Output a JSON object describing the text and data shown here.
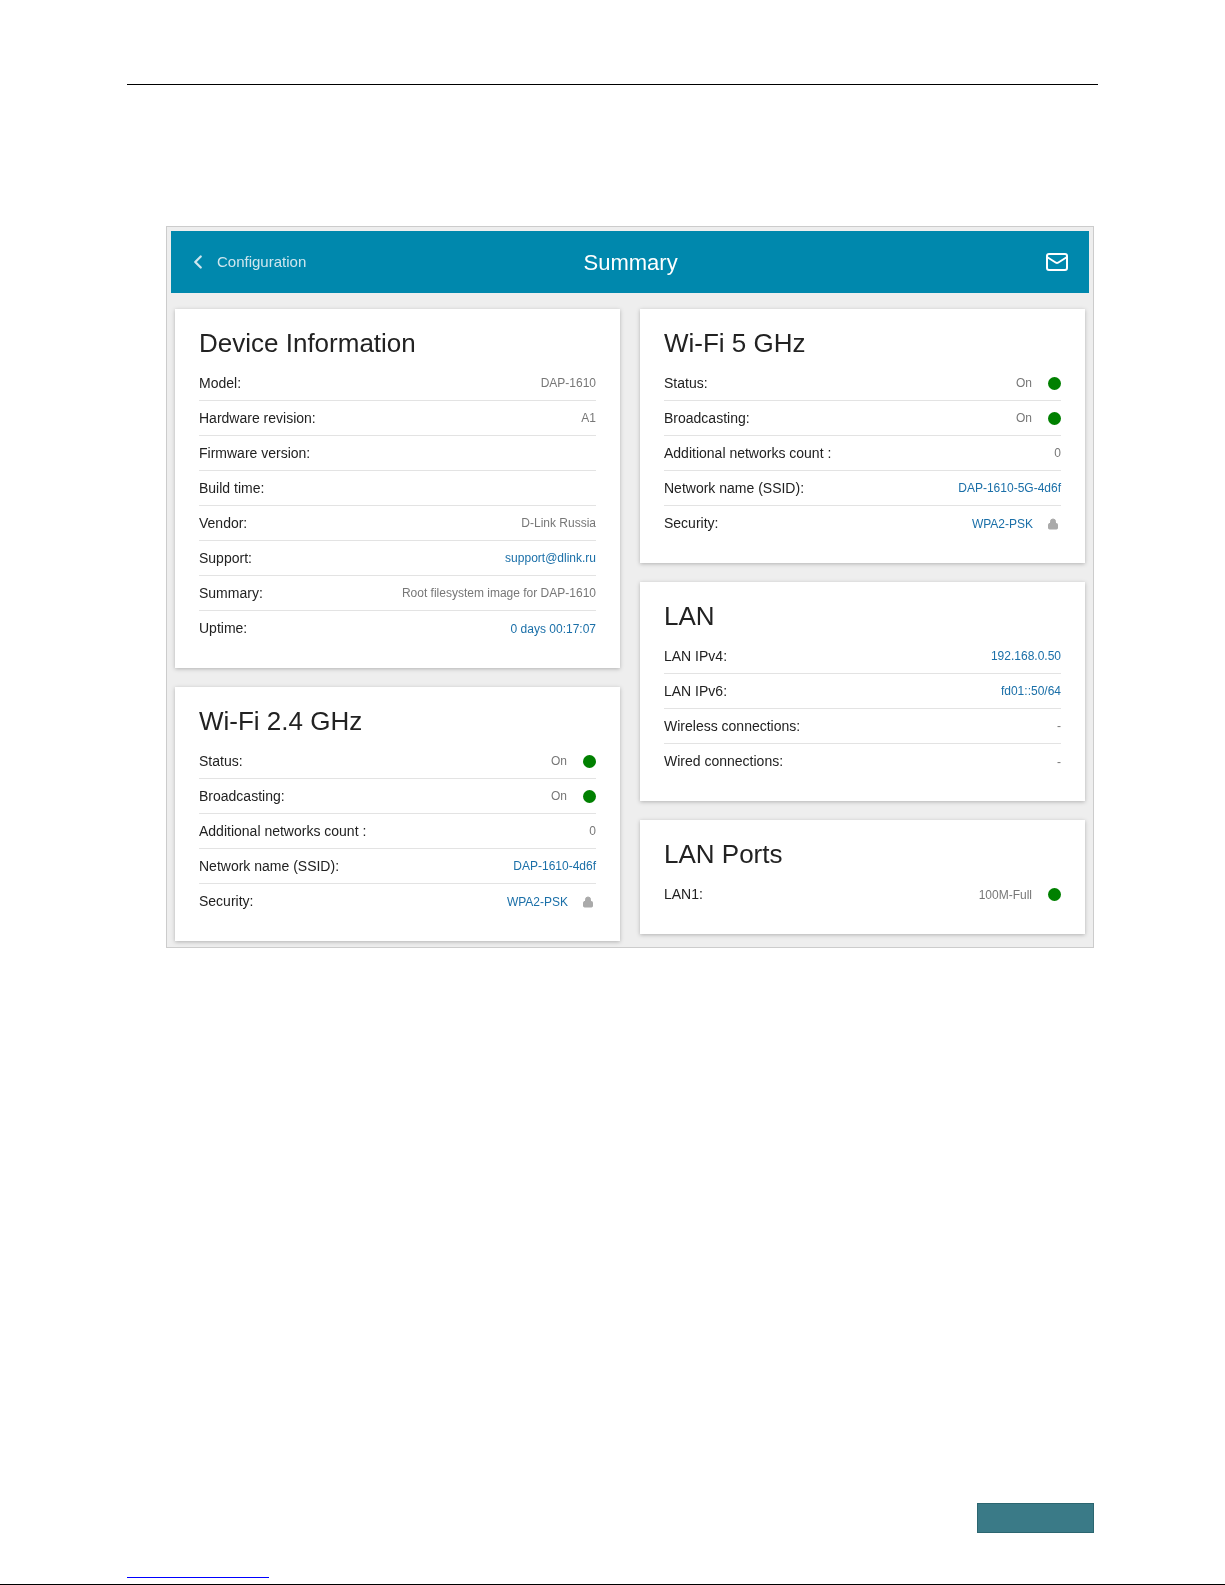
{
  "header": {
    "back_label": "Configuration",
    "title": "Summary"
  },
  "left_column": [
    {
      "title": "Device Information",
      "rows": [
        {
          "label": "Model:",
          "value": "DAP-1610",
          "kind": "plain"
        },
        {
          "label": "Hardware revision:",
          "value": "A1",
          "kind": "plain"
        },
        {
          "label": "Firmware version:",
          "kind": "plain"
        },
        {
          "label": "Build time:",
          "kind": "plain"
        },
        {
          "label": "Vendor:",
          "value": "D-Link Russia",
          "kind": "plain"
        },
        {
          "label": "Support:",
          "value": "support@dlink.ru",
          "kind": "link"
        },
        {
          "label": "Summary:",
          "value": "Root filesystem image for DAP-1610",
          "kind": "plain"
        },
        {
          "label": "Uptime:",
          "value": "0 days 00:17:07",
          "kind": "link"
        }
      ]
    },
    {
      "title": "Wi-Fi 2.4 GHz",
      "rows": [
        {
          "label": "Status:",
          "value": "On",
          "kind": "status",
          "color": "#008000"
        },
        {
          "label": "Broadcasting:",
          "value": "On",
          "kind": "status",
          "color": "#008000"
        },
        {
          "label": "Additional networks count :",
          "value": "0",
          "kind": "plain"
        },
        {
          "label": "Network name (SSID):",
          "value": "DAP-1610-4d6f",
          "kind": "link"
        },
        {
          "label": "Security:",
          "value": "WPA2-PSK",
          "kind": "secure"
        }
      ]
    }
  ],
  "right_column": [
    {
      "title": "Wi-Fi 5 GHz",
      "rows": [
        {
          "label": "Status:",
          "value": "On",
          "kind": "status",
          "color": "#008000"
        },
        {
          "label": "Broadcasting:",
          "value": "On",
          "kind": "status",
          "color": "#008000"
        },
        {
          "label": "Additional networks count :",
          "value": "0",
          "kind": "plain"
        },
        {
          "label": "Network name (SSID):",
          "value": "DAP-1610-5G-4d6f",
          "kind": "link"
        },
        {
          "label": "Security:",
          "value": "WPA2-PSK",
          "kind": "secure"
        }
      ]
    },
    {
      "title": "LAN",
      "rows": [
        {
          "label": "LAN IPv4:",
          "value": "192.168.0.50",
          "kind": "link"
        },
        {
          "label": "LAN IPv6:",
          "value": "fd01::50/64",
          "kind": "link"
        },
        {
          "label": "Wireless connections:",
          "value": "-",
          "kind": "plain"
        },
        {
          "label": "Wired connections:",
          "value": "-",
          "kind": "plain"
        }
      ]
    },
    {
      "title": "LAN Ports",
      "rows": [
        {
          "label": "LAN1:",
          "value": "100M-Full",
          "kind": "status",
          "color": "#008000"
        }
      ]
    }
  ]
}
